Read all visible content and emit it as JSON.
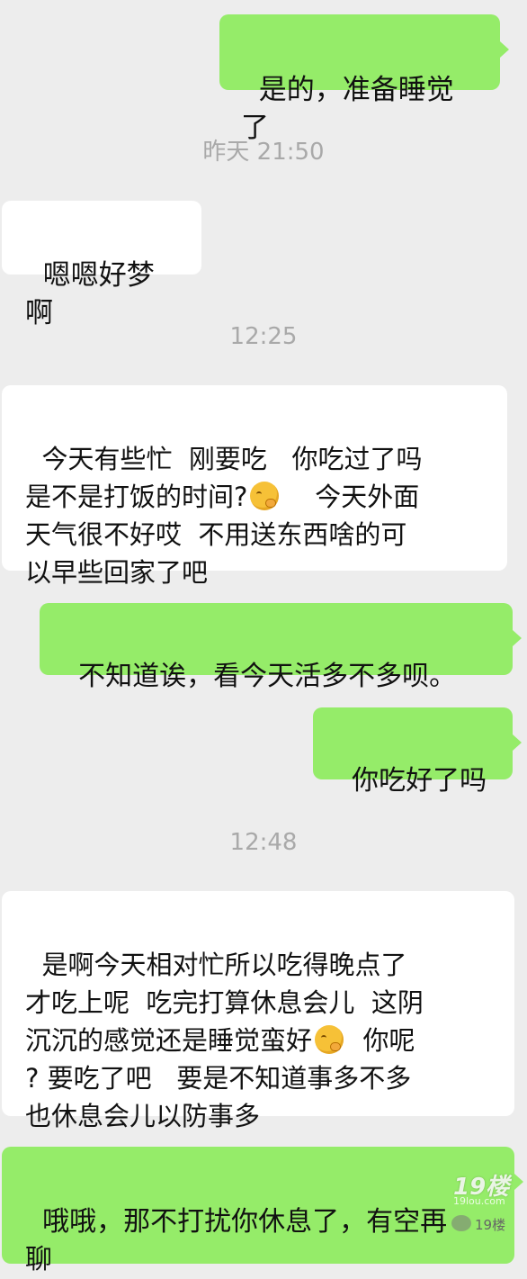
{
  "colors": {
    "background": "#ededed",
    "outgoing_bubble": "#95ec69",
    "incoming_bubble": "#ffffff",
    "timestamp_text": "#a9a9a9"
  },
  "messages": [
    {
      "side": "outgoing",
      "text": "是的，准备睡觉了"
    },
    {
      "side": "incoming",
      "text": "嗯嗯好梦啊"
    },
    {
      "side": "incoming",
      "text_parts": [
        "今天有些忙  刚要吃   你吃过了吗\n是不是打饭的时间?",
        "    今天外面\n天气很不好哎  不用送东西啥的可\n以早些回家了吧"
      ],
      "emoji": "thinking-face-emoji"
    },
    {
      "side": "outgoing",
      "text": "不知道诶，看今天活多不多呗。"
    },
    {
      "side": "outgoing",
      "text": "你吃好了吗"
    },
    {
      "side": "incoming",
      "text_parts": [
        "是啊今天相对忙所以吃得晚点了\n才吃上呢  吃完打算休息会儿  这阴\n沉沉的感觉还是睡觉蛮好",
        "  你呢\n? 要吃了吧   要是不知道事多不多\n也休息会儿以防事多"
      ],
      "emoji": "thinking-face-emoji"
    },
    {
      "side": "outgoing",
      "text": "哦哦，那不打扰你休息了，有空再\n聊"
    }
  ],
  "timestamps": [
    "昨天 21:50",
    "12:25",
    "12:48"
  ],
  "watermark": {
    "logo_text": "19楼",
    "subtext": "19lou.com",
    "label": "19楼"
  }
}
